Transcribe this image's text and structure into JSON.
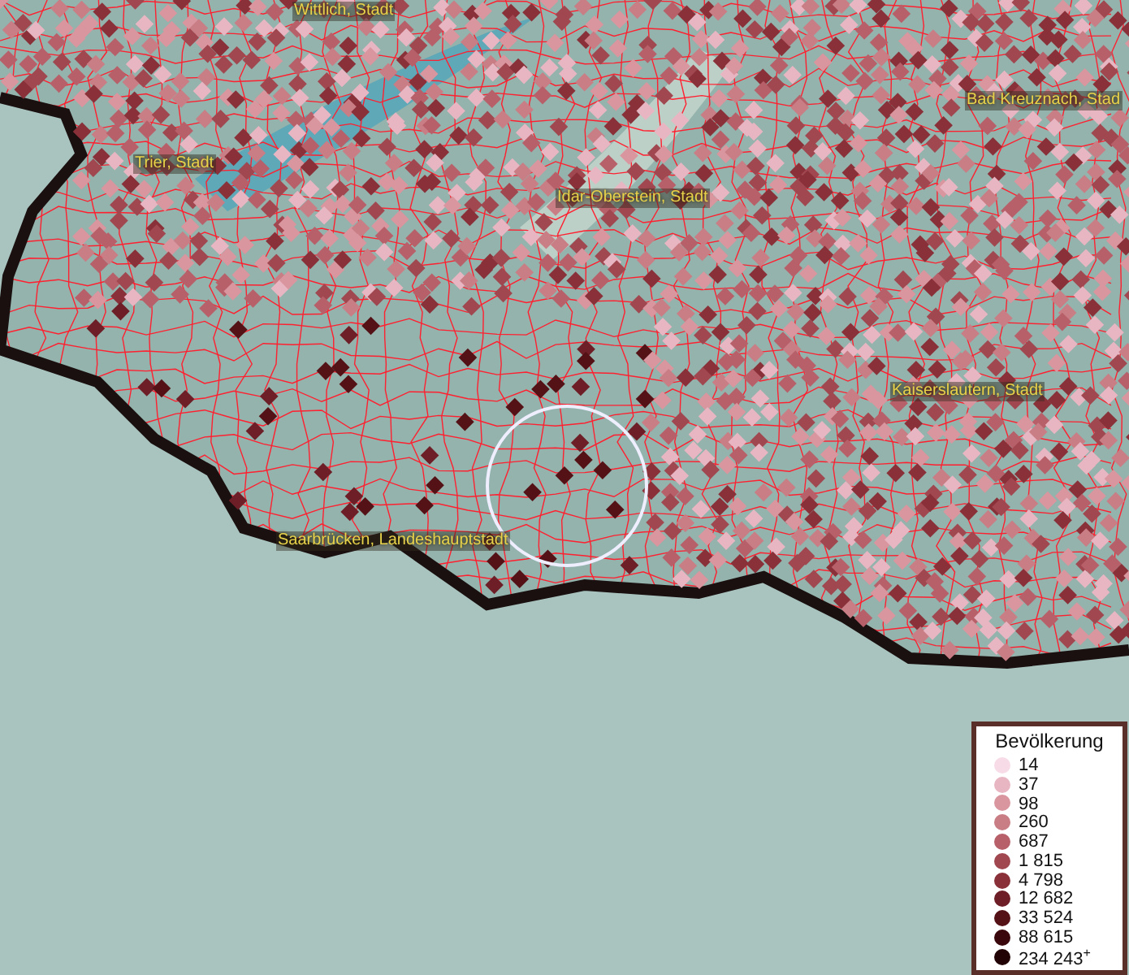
{
  "map": {
    "places": [
      {
        "label": "Wittlich, Stadt"
      },
      {
        "label": "Bad Kreuznach, Stad"
      },
      {
        "label": "Trier, Stadt"
      },
      {
        "label": "Idar-Oberstein, Stadt"
      },
      {
        "label": "Kaiserslautern, Stadt"
      },
      {
        "label": "Saarbrücken, Landeshauptstadt"
      }
    ]
  },
  "legend": {
    "title": "Bevölkerung",
    "items": [
      {
        "label": "14",
        "color": "#f7dbe6"
      },
      {
        "label": "37",
        "color": "#e8b6c2"
      },
      {
        "label": "98",
        "color": "#d9969f"
      },
      {
        "label": "260",
        "color": "#c97d85"
      },
      {
        "label": "687",
        "color": "#b8606a"
      },
      {
        "label": "1 815",
        "color": "#a04750"
      },
      {
        "label": "4 798",
        "color": "#8a3039"
      },
      {
        "label": "12 682",
        "color": "#6e1e26"
      },
      {
        "label": "33 524",
        "color": "#541217"
      },
      {
        "label": "88 615",
        "color": "#3a080c"
      },
      {
        "label": "234 243$^{+}$",
        "color": "#220305"
      }
    ]
  }
}
